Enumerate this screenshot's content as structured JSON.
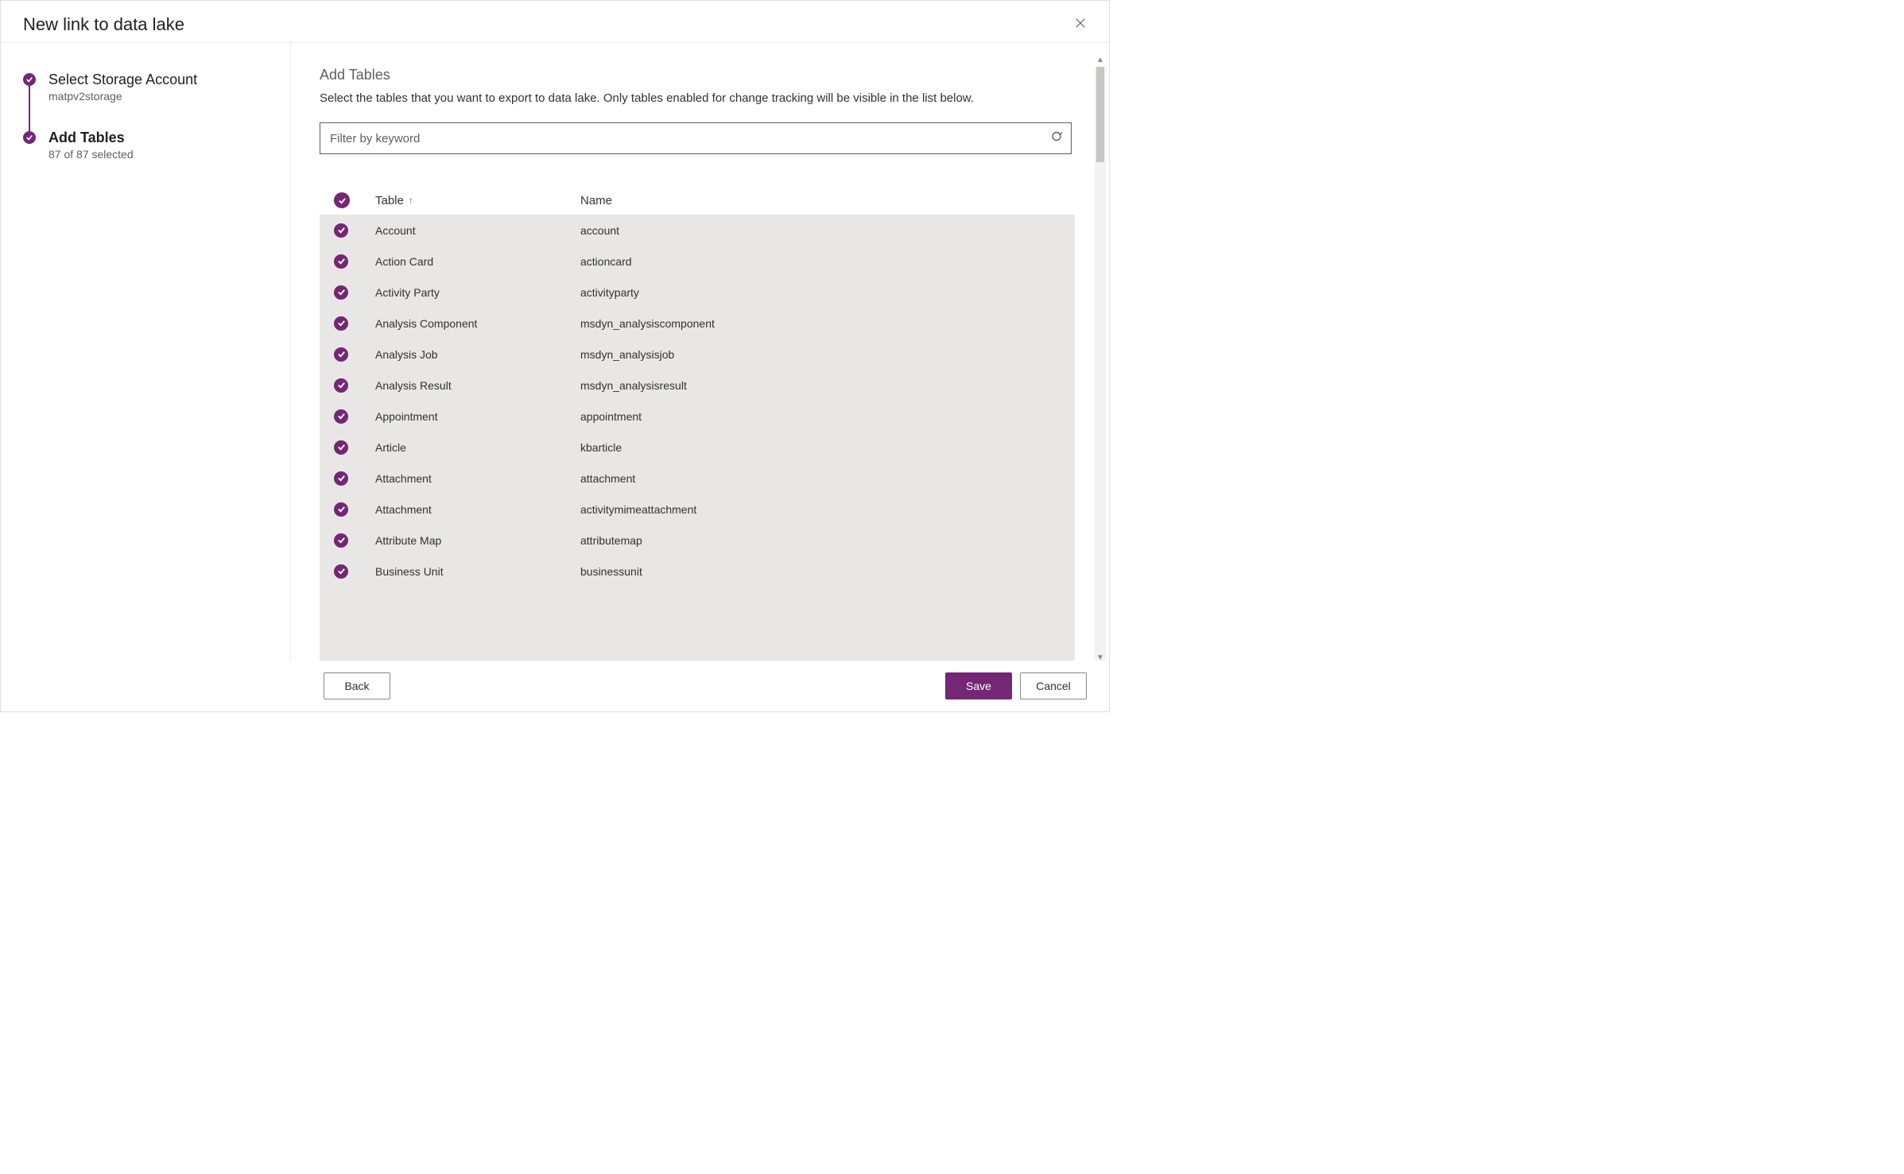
{
  "dialog": {
    "title": "New link to data lake",
    "close_aria": "Close"
  },
  "steps": [
    {
      "title": "Select Storage Account",
      "sub": "matpv2storage",
      "active": false
    },
    {
      "title": "Add Tables",
      "sub": "87 of 87 selected",
      "active": true
    }
  ],
  "panel": {
    "heading": "Add Tables",
    "description": "Select the tables that you want to export to data lake. Only tables enabled for change tracking will be visible in the list below."
  },
  "filter": {
    "placeholder": "Filter by keyword",
    "value": ""
  },
  "columns": {
    "table": "Table",
    "name": "Name",
    "sort_dir": "asc"
  },
  "rows": [
    {
      "table": "Account",
      "name": "account"
    },
    {
      "table": "Action Card",
      "name": "actioncard"
    },
    {
      "table": "Activity Party",
      "name": "activityparty"
    },
    {
      "table": "Analysis Component",
      "name": "msdyn_analysiscomponent"
    },
    {
      "table": "Analysis Job",
      "name": "msdyn_analysisjob"
    },
    {
      "table": "Analysis Result",
      "name": "msdyn_analysisresult"
    },
    {
      "table": "Appointment",
      "name": "appointment"
    },
    {
      "table": "Article",
      "name": "kbarticle"
    },
    {
      "table": "Attachment",
      "name": "attachment"
    },
    {
      "table": "Attachment",
      "name": "activitymimeattachment"
    },
    {
      "table": "Attribute Map",
      "name": "attributemap"
    },
    {
      "table": "Business Unit",
      "name": "businessunit"
    }
  ],
  "footer": {
    "back": "Back",
    "save": "Save",
    "cancel": "Cancel"
  },
  "colors": {
    "accent": "#742774"
  }
}
